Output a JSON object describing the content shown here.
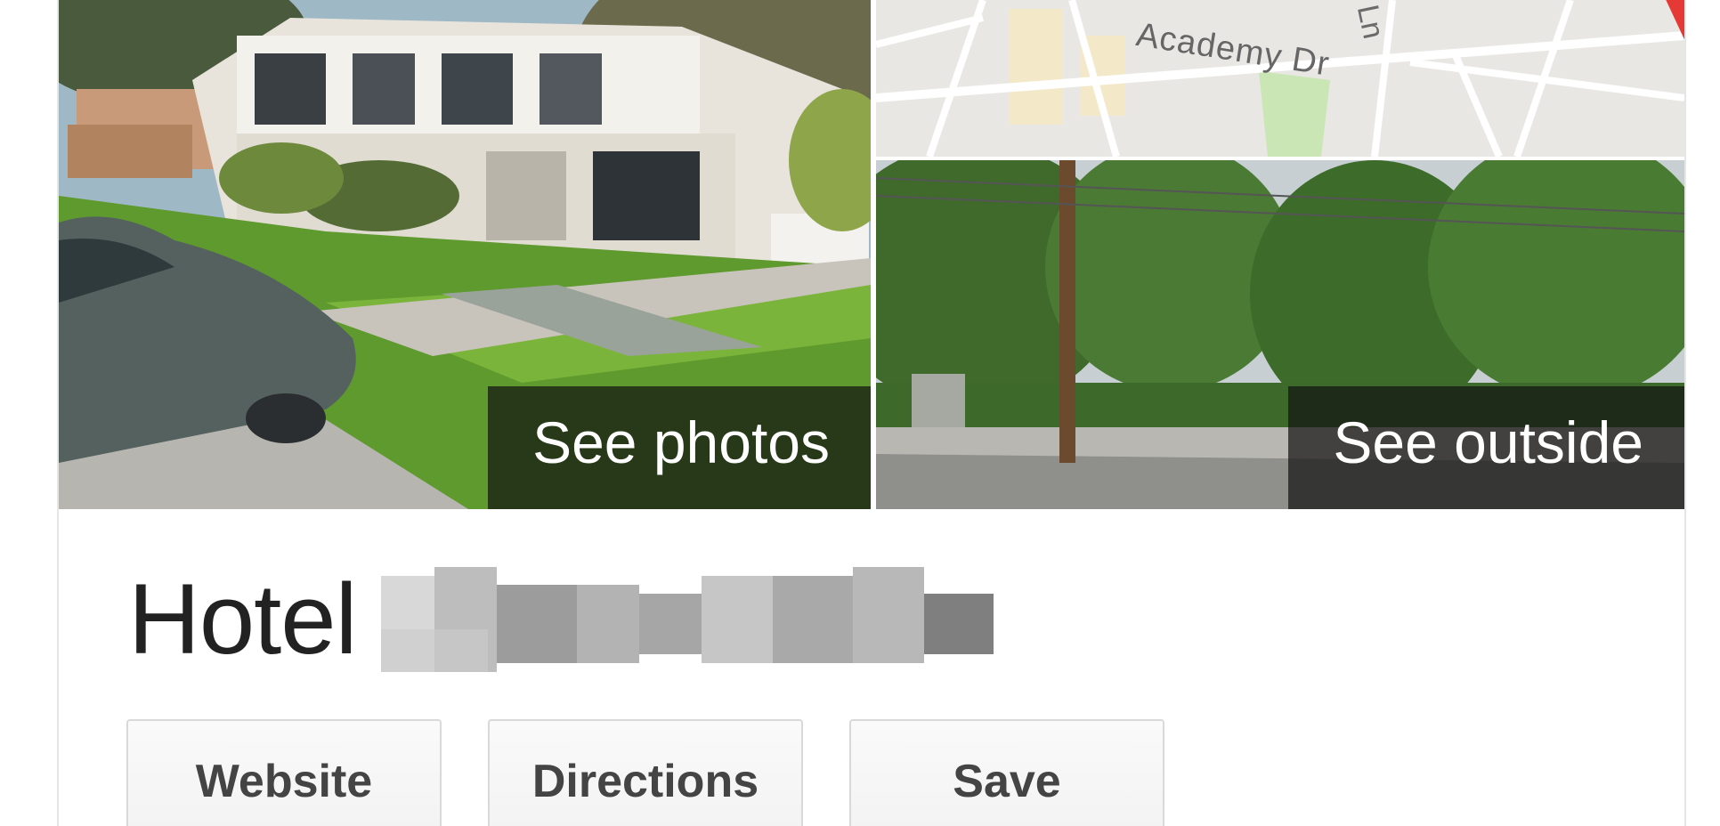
{
  "photos": {
    "main_label": "See photos",
    "street_label": "See outside"
  },
  "map": {
    "street_name": "Academy Dr",
    "street_name_2": "Ln",
    "pin_color": "#e53935"
  },
  "business": {
    "title_visible": "Hotel"
  },
  "actions": {
    "website": "Website",
    "directions": "Directions",
    "save": "Save"
  },
  "colors": {
    "overlay": "#141414",
    "title": "#222222",
    "button_text": "#444444",
    "button_border": "#d9d9d9"
  }
}
